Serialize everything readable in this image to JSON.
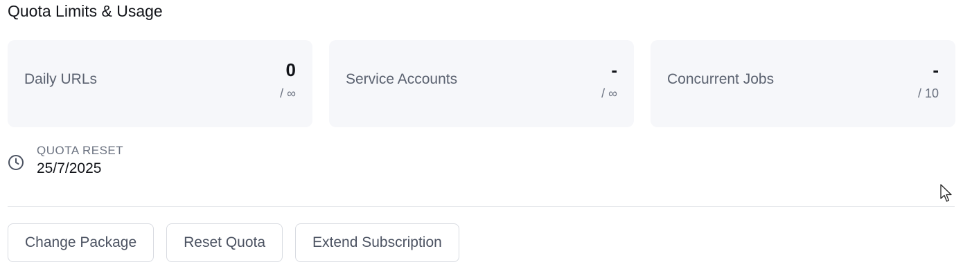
{
  "title": "Quota Limits & Usage",
  "cards": [
    {
      "label": "Daily URLs",
      "value": "0",
      "limit": "/ ∞"
    },
    {
      "label": "Service Accounts",
      "value": "-",
      "limit": "/ ∞"
    },
    {
      "label": "Concurrent Jobs",
      "value": "-",
      "limit": "/ 10"
    }
  ],
  "reset": {
    "icon": "clock-icon",
    "label": "QUOTA RESET",
    "date": "25/7/2025"
  },
  "actions": {
    "change_package": "Change Package",
    "reset_quota": "Reset Quota",
    "extend_subscription": "Extend Subscription"
  },
  "colors": {
    "card_bg": "#f6f7fa",
    "divider": "#e5e7eb",
    "button_border": "#d8dbe1",
    "muted_text": "#6b7280"
  }
}
